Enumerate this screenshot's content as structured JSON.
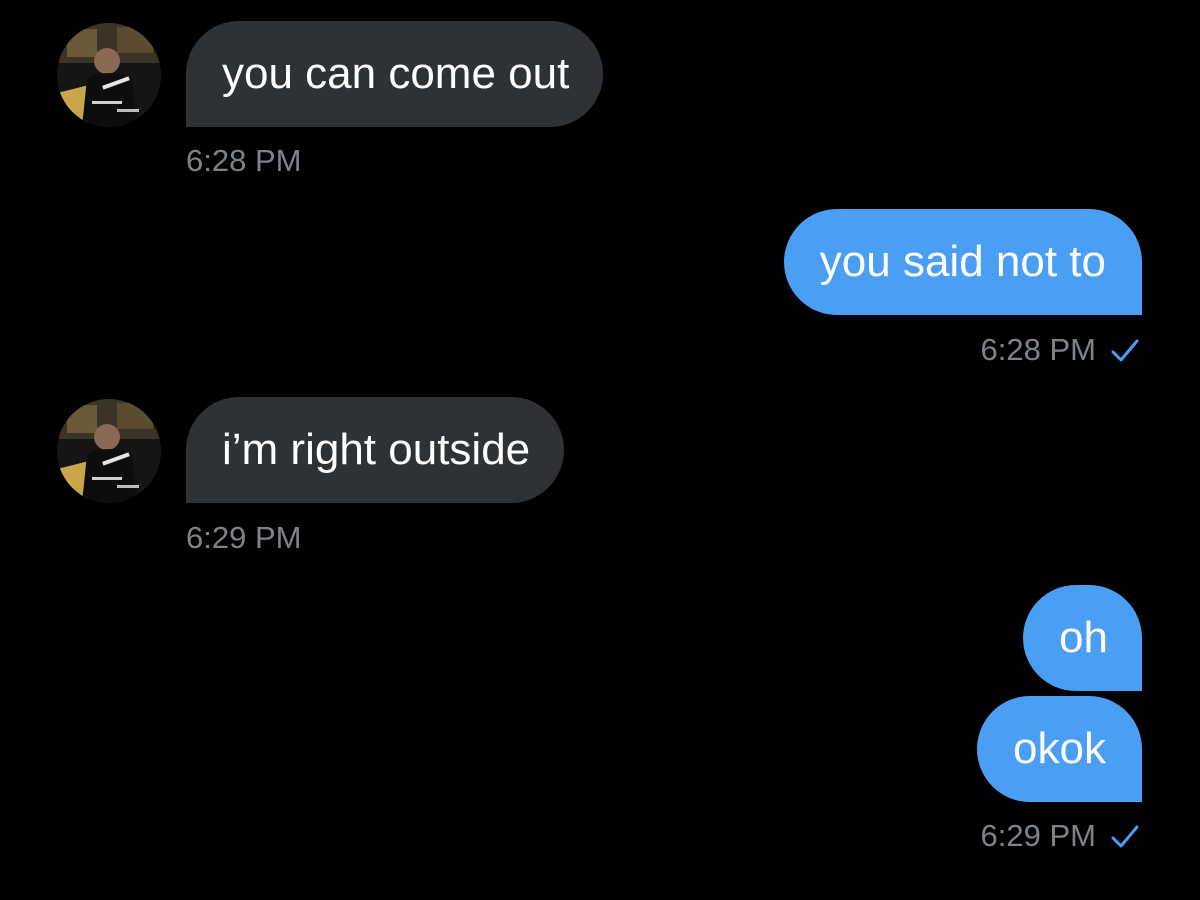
{
  "conversation": {
    "messages": [
      {
        "direction": "incoming",
        "text": "you can come out",
        "time": "6:28 PM"
      },
      {
        "direction": "outgoing",
        "text": "you said not to",
        "time": "6:28 PM",
        "status": "read"
      },
      {
        "direction": "incoming",
        "text": "i’m right outside",
        "time": "6:29 PM"
      },
      {
        "direction": "outgoing",
        "text": "oh"
      },
      {
        "direction": "outgoing",
        "text": "okok",
        "time": "6:29 PM",
        "status": "read"
      }
    ]
  },
  "colors": {
    "background": "#000000",
    "incoming_bubble": "#2f3235",
    "outgoing_bubble": "#4a9ff5",
    "timestamp": "#7e8389",
    "read_check": "#4a9ff5"
  },
  "icons": {
    "avatar": "user-avatar-photo",
    "read_receipt": "checkmark-icon"
  }
}
